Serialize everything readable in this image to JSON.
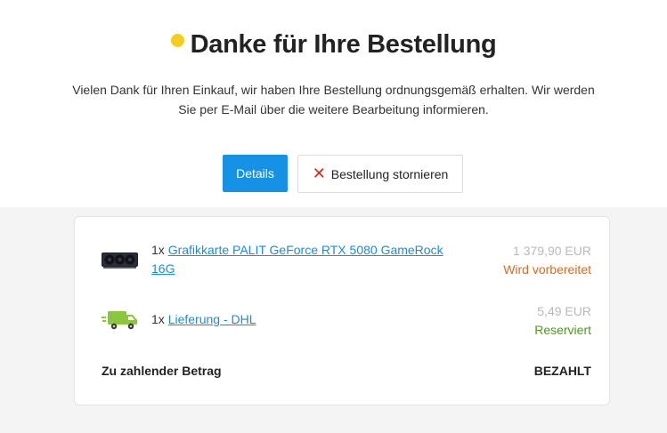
{
  "header": {
    "title": "Danke für Ihre Bestellung",
    "subtitle": "Vielen Dank für Ihren Einkauf, wir haben Ihre Bestellung ordnungsgemäß erhalten. Wir werden Sie per E-Mail über die weitere Bearbeitung informieren."
  },
  "actions": {
    "details_label": "Details",
    "cancel_label": "Bestellung stornieren",
    "cancel_icon": "✕"
  },
  "order": {
    "items": [
      {
        "qty": "1x",
        "name": "Grafikkarte PALIT GeForce RTX 5080 GameRock 16G",
        "price": "1 379,90 EUR",
        "status": "Wird vorbereitet",
        "icon": "graphics-card-icon"
      },
      {
        "qty": "1x",
        "name": "Lieferung - DHL",
        "price": "5,49 EUR",
        "status": "Reserviert",
        "icon": "delivery-truck-icon"
      }
    ],
    "total_label": "Zu zahlender Betrag",
    "total_value": "BEZAHLT"
  },
  "colors": {
    "accent": "#1592e6",
    "dot": "#f5cd1d",
    "status_preparing": "#d86c1d",
    "status_reserved": "#4d9a1b",
    "cancel_x": "#e2231a"
  }
}
